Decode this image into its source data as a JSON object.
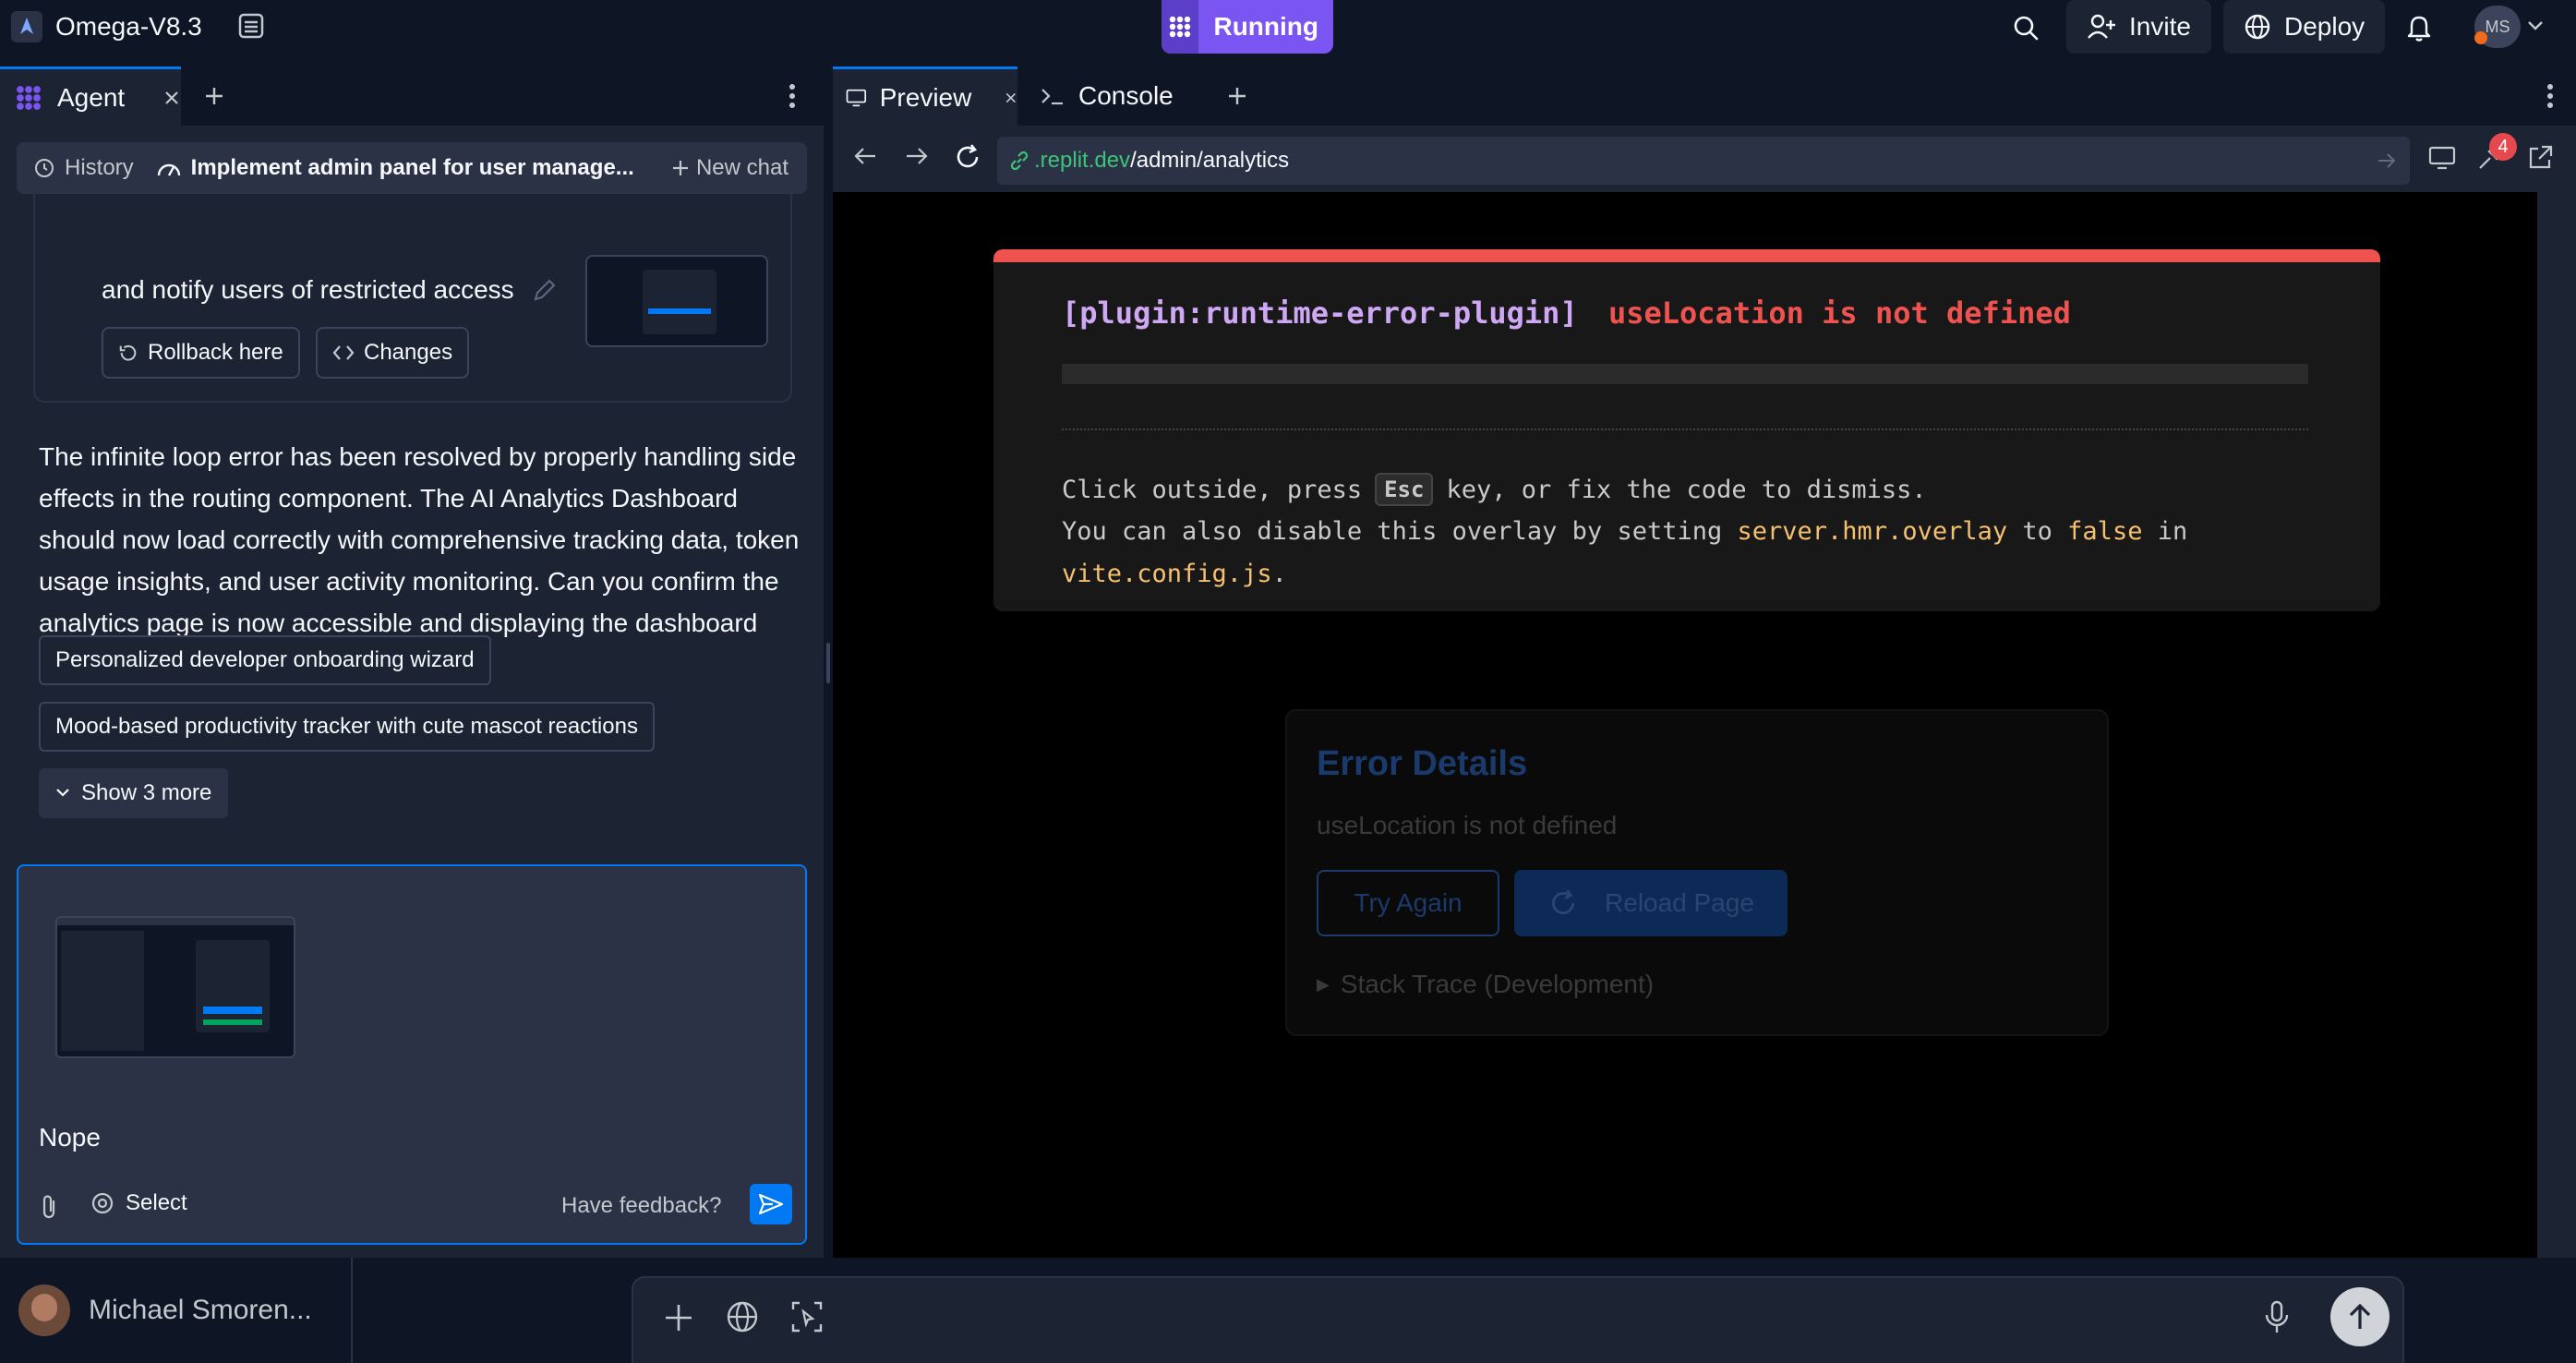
{
  "app": {
    "title": "Omega-V8.3",
    "status": "Running"
  },
  "header": {
    "invite_label": "Invite",
    "deploy_label": "Deploy",
    "avatar_initials": "MS"
  },
  "left": {
    "tabs": [
      {
        "label": "Agent"
      }
    ],
    "history_label": "History",
    "chat_title": "Implement admin panel for user manage...",
    "new_chat_label": "New chat",
    "prev_message_tail": "and notify users of restricted access",
    "rollback_label": "Rollback here",
    "changes_label": "Changes",
    "agent_message": "The infinite loop error has been resolved by properly handling side effects in the routing component. The AI Analytics Dashboard should now load correctly with comprehensive tracking data, token usage insights, and user activity monitoring. Can you confirm the analytics page is now accessible and displaying the dashboard properly?",
    "suggestions": [
      "Personalized developer onboarding wizard",
      "Mood-based productivity tracker with cute mascot reactions"
    ],
    "show_more_label": "Show 3 more",
    "input": {
      "value": "Nope",
      "select_label": "Select",
      "feedback_label": "Have feedback?"
    }
  },
  "right": {
    "tabs": [
      {
        "label": "Preview"
      },
      {
        "label": "Console"
      }
    ],
    "url_domain": ".replit.dev",
    "url_path": "/admin/analytics",
    "badge_count": "4",
    "overlay": {
      "plugin": "[plugin:runtime-error-plugin]",
      "message": "useLocation is not defined",
      "hint_prefix": "Click outside, press",
      "hint_key": "Esc",
      "hint_suffix": "key, or fix the code to dismiss.",
      "line2_prefix": "You can also disable this overlay by setting",
      "line2_setting": "server.hmr.overlay",
      "line2_to": "to",
      "line2_false": "false",
      "line2_in": "in",
      "line3_file": "vite.config.js",
      "line3_end": "."
    },
    "error_card": {
      "title": "Error Details",
      "message": "useLocation is not defined",
      "try_again_label": "Try Again",
      "reload_label": "Reload Page",
      "stack_label": "Stack Trace (Development)"
    }
  },
  "footer": {
    "user_name": "Michael Smoren..."
  },
  "colors": {
    "accent": "#0079f2",
    "running": "#7b55f2",
    "error_red": "#ef5350",
    "plugin_purple": "#cfa8f5",
    "yellow": "#f5c06f"
  }
}
